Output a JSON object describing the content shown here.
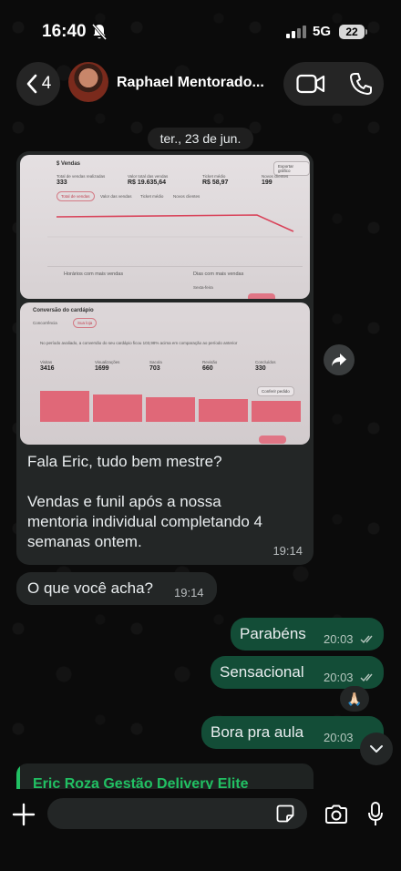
{
  "status_bar": {
    "time": "16:40",
    "network": "5G",
    "battery": "22"
  },
  "header": {
    "back_count": "4",
    "contact_name": "Raphael Mentorado..."
  },
  "date_separator": "ter., 23 de jun.",
  "screenshot1": {
    "title": "$ Vendas",
    "metrics": [
      {
        "label": "Total de vendas realizadas",
        "value": "333"
      },
      {
        "label": "Valor total das vendas",
        "value": "R$ 19.635,64"
      },
      {
        "label": "Ticket médio",
        "value": "R$ 58,97"
      },
      {
        "label": "Novos clientes",
        "value": "199"
      }
    ],
    "tabs": [
      "Total de vendas",
      "Valor das vendas",
      "Ticket médio",
      "Novos clientes"
    ],
    "export_button": "Exportar gráfico",
    "footer_left": "Horários com mais vendas",
    "footer_right": "Dias com mais vendas",
    "footer_right_value": "Sexta-feira"
  },
  "screenshot2": {
    "title": "Conversão do cardápio",
    "tabs": [
      "Concorrência",
      "Sua loja"
    ],
    "summary": "No período avaliado, a conversão do seu cardápio ficou 103,98% acima em comparação ao período anterior",
    "funnel": [
      {
        "label": "Visitas",
        "value": "3416"
      },
      {
        "label": "Visualizações",
        "value": "1699"
      },
      {
        "label": "Sacola",
        "value": "703"
      },
      {
        "label": "Revisão",
        "value": "660"
      },
      {
        "label": "Concluídos",
        "value": "330"
      }
    ],
    "action": "Conferir pedido"
  },
  "messages": {
    "m1_lines": [
      "Fala Eric, tudo bem mestre?",
      "Vendas e funil após a nossa",
      "mentoria individual completando 4",
      "semanas ontem."
    ],
    "m1_time": "19:14",
    "m2_text": "O que você acha?",
    "m2_time": "19:14",
    "m3_text": "Parabéns",
    "m3_time": "20:03",
    "m4_text": "Sensacional",
    "m4_time": "20:03",
    "m4_reaction": "🙏🏻",
    "m5_text": "Bora pra aula",
    "m5_time": "20:03"
  },
  "quoted": {
    "name": "Eric Roza Gestão Delivery Elite"
  },
  "input": {
    "placeholder": ""
  }
}
